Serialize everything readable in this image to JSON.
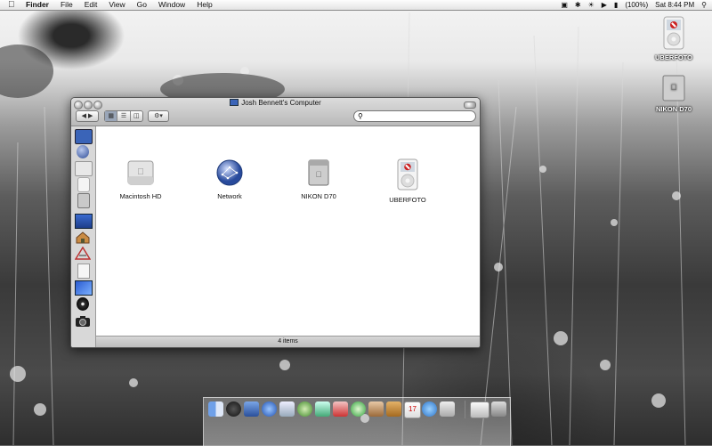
{
  "menubar": {
    "app_name": "Finder",
    "menus": [
      "File",
      "Edit",
      "View",
      "Go",
      "Window",
      "Help"
    ],
    "battery": "(100%)",
    "clock": "Sat 8:44 PM"
  },
  "desktop_icons": [
    {
      "label": "UBERFOTO"
    },
    {
      "label": "NIKON D70"
    }
  ],
  "window": {
    "title": "Josh Bennett's Computer",
    "status": "4 items",
    "items": [
      {
        "label": "Macintosh HD",
        "icon": "hard-drive-icon"
      },
      {
        "label": "Network",
        "icon": "network-globe-icon"
      },
      {
        "label": "NIKON D70",
        "icon": "external-drive-icon"
      },
      {
        "label": "UBERFOTO",
        "icon": "ipod-icon"
      }
    ]
  },
  "colors": {
    "accent": "#3a64b8"
  }
}
